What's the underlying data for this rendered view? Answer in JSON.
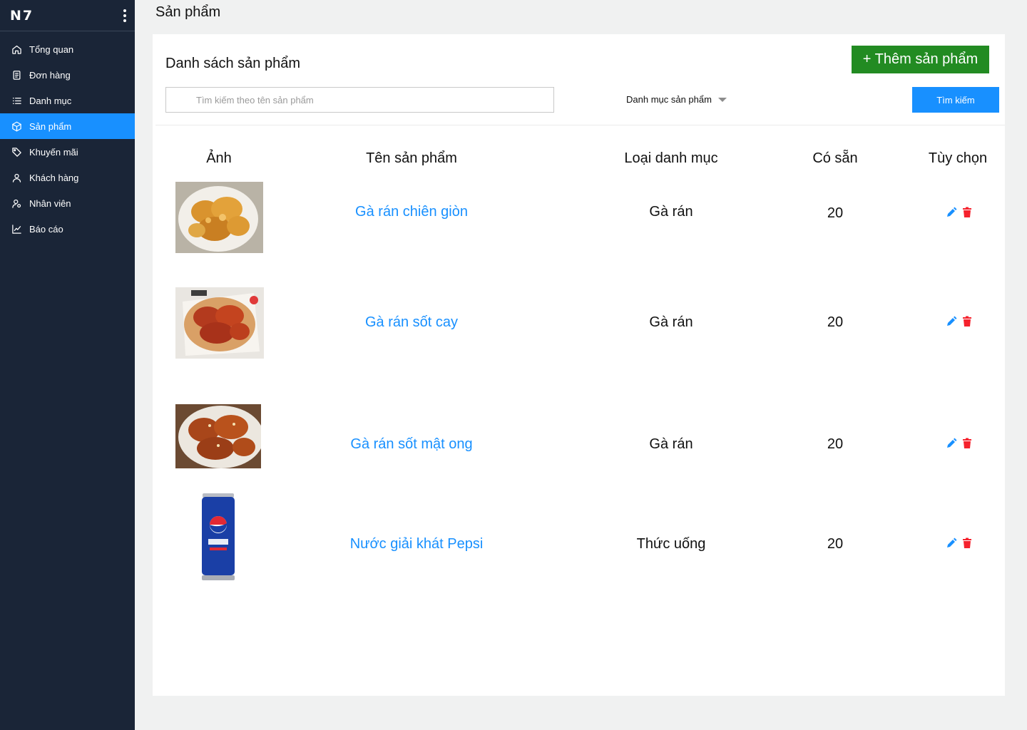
{
  "app": {
    "brand": "N7"
  },
  "sidebar": {
    "items": [
      {
        "label": "Tổng quan",
        "icon": "home-icon"
      },
      {
        "label": "Đơn hàng",
        "icon": "document-icon"
      },
      {
        "label": "Danh mục",
        "icon": "list-icon"
      },
      {
        "label": "Sản phẩm",
        "icon": "box-icon",
        "active": true
      },
      {
        "label": "Khuyến mãi",
        "icon": "tag-icon"
      },
      {
        "label": "Khách hàng",
        "icon": "user-icon"
      },
      {
        "label": "Nhân viên",
        "icon": "user-settings-icon"
      },
      {
        "label": "Báo cáo",
        "icon": "chart-line-icon"
      }
    ]
  },
  "header": {
    "title": "Sản phẩm"
  },
  "main": {
    "title": "Danh sách sản phẩm",
    "add_button": "+ Thêm sản phẩm",
    "search": {
      "placeholder": "Tìm kiếm theo tên sản phẩm",
      "value": ""
    },
    "category_filter": {
      "label": "Danh mục sản phẩm"
    },
    "search_button": "Tìm kiếm",
    "columns": [
      "Ảnh",
      "Tên sản phẩm",
      "Loại danh mục",
      "Có sẵn",
      "Tùy chọn"
    ],
    "products": [
      {
        "name": "Gà rán chiên giòn",
        "category": "Gà rán",
        "stock": "20",
        "image": "fried-chicken-crispy-photo"
      },
      {
        "name": "Gà rán sốt cay",
        "category": "Gà rán",
        "stock": "20",
        "image": "spicy-fried-chicken-photo"
      },
      {
        "name": "Gà rán sốt mật ong",
        "category": "Gà rán",
        "stock": "20",
        "image": "honey-fried-chicken-photo"
      },
      {
        "name": "Nước giải khát Pepsi",
        "category": "Thức uống",
        "stock": "20",
        "image": "pepsi-can-photo"
      }
    ]
  },
  "colors": {
    "sidebar_bg": "#1a2537",
    "accent": "#1890ff",
    "add_button": "#228b22",
    "delete": "#f5222d",
    "edit": "#1890ff"
  }
}
